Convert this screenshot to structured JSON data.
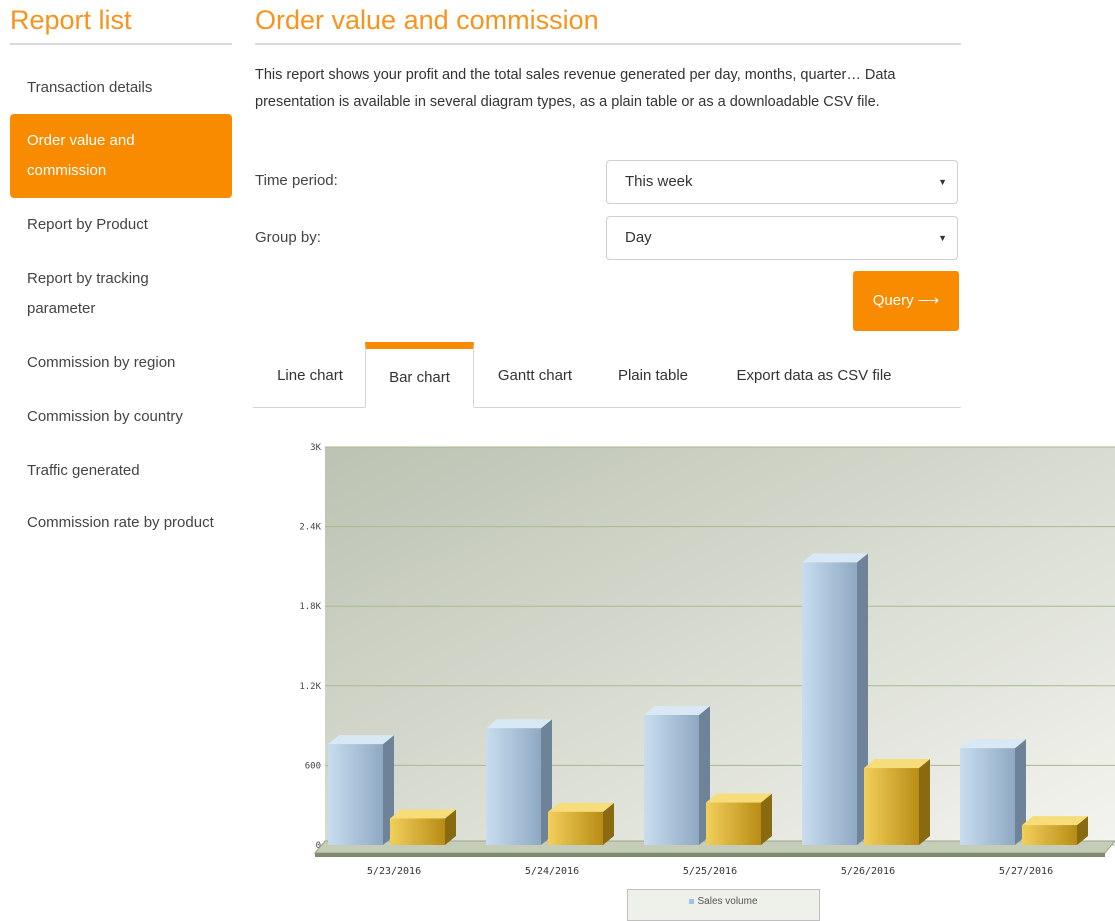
{
  "sidebar": {
    "title": "Report list",
    "items": [
      {
        "label": "Transaction details"
      },
      {
        "label": "Order value and commission"
      },
      {
        "label": "Report by Product"
      },
      {
        "label": "Report by tracking parameter"
      },
      {
        "label": "Commission by region"
      },
      {
        "label": "Commission by country"
      },
      {
        "label": "Traffic generated"
      },
      {
        "label": "Commission rate by product"
      }
    ],
    "active_index": 1
  },
  "main": {
    "title": "Order value and commission",
    "description": "This report shows your profit and the total sales revenue generated per day, months, quarter… Data presentation is available in several diagram types, as a plain table or as a downloadable CSV file.",
    "time_period": {
      "label": "Time period:",
      "value": "This week"
    },
    "group_by": {
      "label": "Group by:",
      "value": "Day"
    },
    "query_label": "Query ⟶",
    "tabs": [
      {
        "label": "Line chart"
      },
      {
        "label": "Bar chart"
      },
      {
        "label": "Gantt chart"
      },
      {
        "label": "Plain table"
      },
      {
        "label": "Export data as CSV file"
      }
    ],
    "active_tab": 1
  },
  "colors": {
    "accent": "#f88b00",
    "title": "#f7941d"
  },
  "chart_data": {
    "type": "bar",
    "categories": [
      "5/23/2016",
      "5/24/2016",
      "5/25/2016",
      "5/26/2016",
      "5/27/2016"
    ],
    "series": [
      {
        "name": "Sales volume",
        "values": [
          760,
          880,
          980,
          2130,
          730
        ],
        "color": "#a9c6e2"
      },
      {
        "name": "",
        "values": [
          200,
          250,
          320,
          580,
          150
        ],
        "color": "#d9a92a"
      }
    ],
    "yticks": [
      "0",
      "600",
      "1.2K",
      "1.8K",
      "2.4K",
      "3K"
    ],
    "ylim": [
      0,
      3000
    ],
    "grid": true,
    "legend_position": "bottom"
  }
}
